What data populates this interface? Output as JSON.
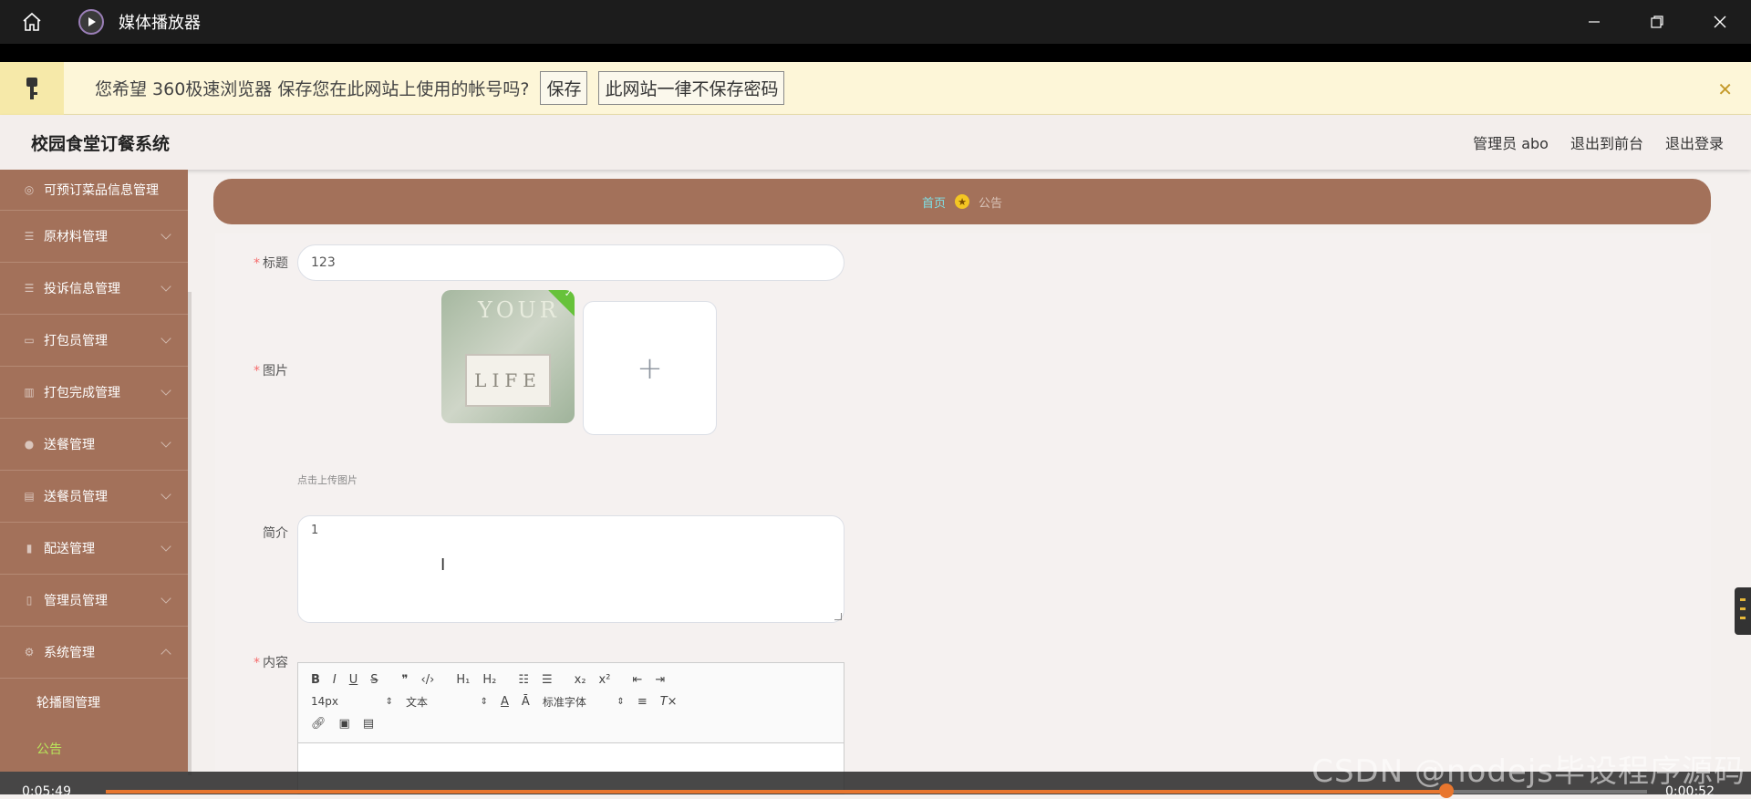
{
  "window": {
    "title": "媒体播放器"
  },
  "password_bar": {
    "message": "您希望 360极速浏览器 保存您在此网站上使用的帐号吗?",
    "save_label": "保存",
    "never_label": "此网站一律不保存密码"
  },
  "header": {
    "brand": "校园食堂订餐系统",
    "admin": "管理员 abo",
    "to_front": "退出到前台",
    "logout": "退出登录"
  },
  "sidebar": {
    "items": [
      {
        "label": "可预订菜品信息管理",
        "icon": "compass-icon"
      },
      {
        "label": "原材料管理",
        "icon": "list-icon"
      },
      {
        "label": "投诉信息管理",
        "icon": "list-icon"
      },
      {
        "label": "打包员管理",
        "icon": "id-card-icon"
      },
      {
        "label": "打包完成管理",
        "icon": "building-icon"
      },
      {
        "label": "送餐管理",
        "icon": "user-icon"
      },
      {
        "label": "送餐员管理",
        "icon": "clipboard-icon"
      },
      {
        "label": "配送管理",
        "icon": "bar-chart-icon"
      },
      {
        "label": "管理员管理",
        "icon": "mic-icon"
      },
      {
        "label": "系统管理",
        "icon": "gear-icon"
      }
    ],
    "subitems": [
      {
        "label": "轮播图管理"
      },
      {
        "label": "公告"
      }
    ]
  },
  "breadcrumb": {
    "home": "首页",
    "current": "公告"
  },
  "form": {
    "title_label": "标题",
    "title_value": "123",
    "image_label": "图片",
    "image_text_top": "YOUR",
    "image_text_card": "LIFE",
    "upload_hint": "点击上传图片",
    "summary_label": "简介",
    "summary_value": "1",
    "content_label": "内容"
  },
  "editor": {
    "font_size": "14px",
    "block_type": "文本",
    "font_family": "标准字体"
  },
  "player": {
    "elapsed": "0:05:49",
    "remaining": "0:00:52",
    "progress_fraction": 0.87
  },
  "watermark": "CSDN @nodejs毕设程序源码"
}
